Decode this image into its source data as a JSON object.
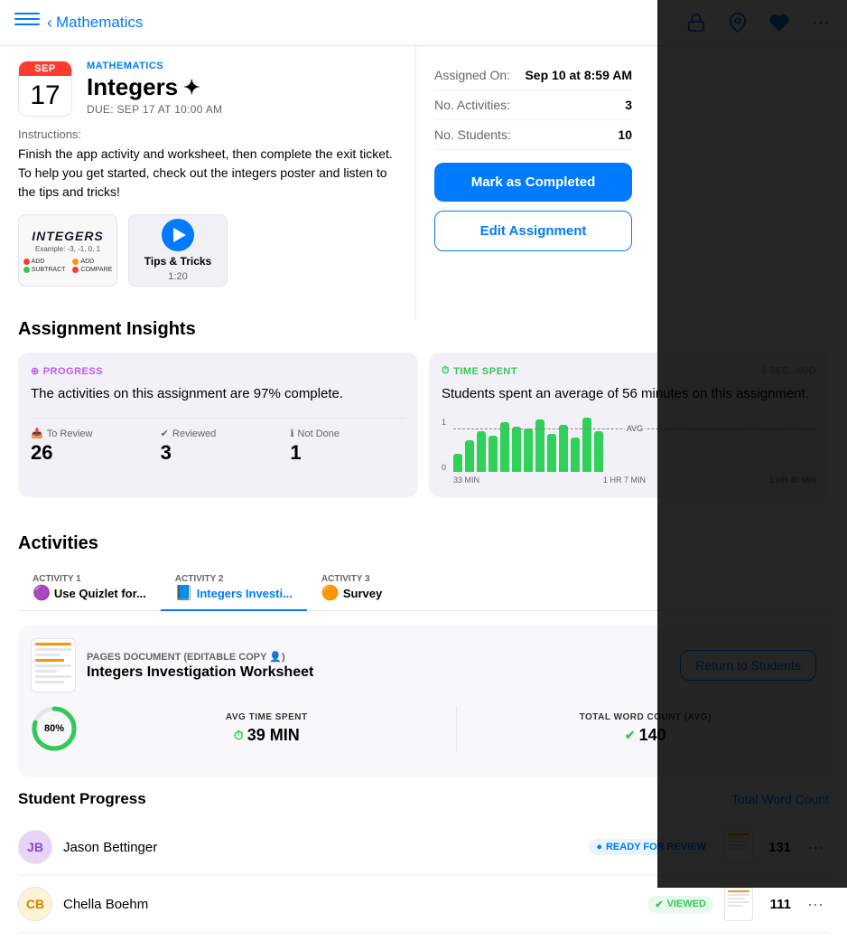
{
  "header": {
    "back_label": "Mathematics",
    "top_icons": [
      "lock-icon",
      "pin-icon",
      "heart-icon",
      "more-icon"
    ]
  },
  "assignment": {
    "month": "SEP",
    "day": "17",
    "subject": "MATHEMATICS",
    "title": "Integers",
    "sparkle": "✦",
    "due_label": "DUE: SEP 17 AT 10:00 AM",
    "instructions_label": "Instructions:",
    "instructions_text": "Finish the app activity and worksheet, then complete the exit ticket. To help you get started, check out the integers poster and listen to the tips and tricks!",
    "attachment1": {
      "title": "INTEGERS",
      "subtitle": "Example: -3, -1, 0, 1"
    },
    "attachment2": {
      "label": "Tips & Tricks",
      "duration": "1:20"
    }
  },
  "meta": {
    "assigned_label": "Assigned On:",
    "assigned_value": "Sep 10 at 8:59 AM",
    "activities_label": "No. Activities:",
    "activities_value": "3",
    "students_label": "No. Students:",
    "students_value": "10"
  },
  "buttons": {
    "mark_complete": "Mark as Completed",
    "edit": "Edit Assignment"
  },
  "insights": {
    "section_title": "Assignment Insights",
    "progress_card": {
      "label": "PROGRESS",
      "text": "The activities on this assignment are 97% complete.",
      "stats": [
        {
          "icon": "inbox",
          "label": "To Review",
          "value": "26"
        },
        {
          "icon": "check",
          "label": "Reviewed",
          "value": "3"
        },
        {
          "icon": "info",
          "label": "Not Done",
          "value": "1"
        }
      ]
    },
    "time_card": {
      "label": "TIME SPENT",
      "time_ago": "3 sec. ago",
      "text": "Students spent an average of 56 minutes on this assignment.",
      "chart_bars": [
        20,
        35,
        45,
        40,
        55,
        50,
        48,
        58,
        42,
        52,
        38,
        60,
        45
      ],
      "avg_label": "AVG",
      "x_labels": [
        "33 MIN",
        "1 HR 7 MIN",
        "1 HR 40 MIN"
      ],
      "y_labels": [
        "1",
        "0"
      ]
    }
  },
  "activities": {
    "section_title": "Activities",
    "tabs": [
      {
        "number": "ACTIVITY 1",
        "name": "Use Quizlet for...",
        "active": false,
        "icon": "🟣"
      },
      {
        "number": "ACTIVITY 2",
        "name": "Integers Investi...",
        "active": true,
        "icon": "📘"
      },
      {
        "number": "ACTIVITY 3",
        "name": "Survey",
        "active": false,
        "icon": "🟠"
      }
    ],
    "current": {
      "type": "PAGES DOCUMENT (EDITABLE COPY 👤)",
      "name": "Integers Investigation Worksheet",
      "return_btn": "Return to Students",
      "progress_pct": 80,
      "avg_time_label": "AVG TIME SPENT",
      "avg_time_value": "39 MIN",
      "word_count_label": "TOTAL WORD COUNT (AVG)",
      "word_count_value": "140"
    }
  },
  "student_progress": {
    "title": "Student Progress",
    "link": "Total Word Count",
    "students": [
      {
        "initials": "JB",
        "name": "Jason Bettinger",
        "status": "READY FOR REVIEW",
        "status_type": "review",
        "word_count": "131",
        "avatar_color": "#E8D5F5"
      },
      {
        "initials": "CB",
        "name": "Chella Boehm",
        "status": "VIEWED",
        "status_type": "viewed",
        "word_count": "111",
        "avatar_color": "#FFF3D6"
      }
    ]
  }
}
